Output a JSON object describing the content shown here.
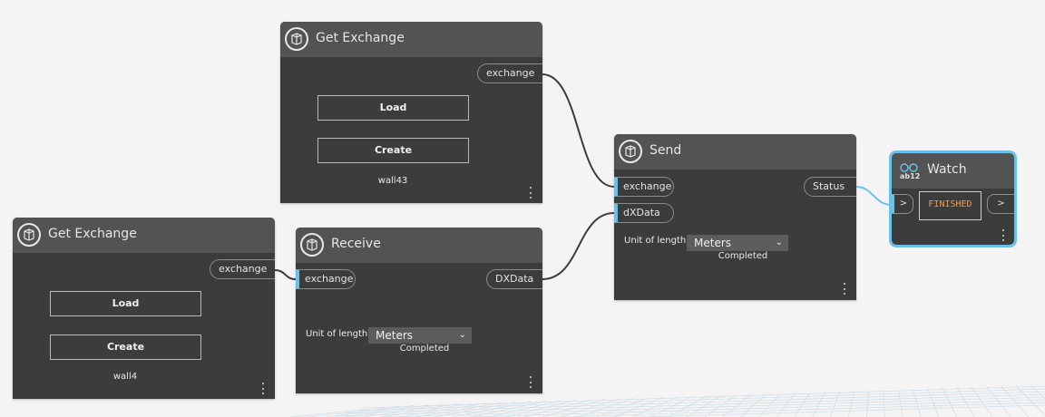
{
  "nodes": {
    "get_exchange_top": {
      "title": "Get Exchange",
      "output_port": "exchange",
      "load_label": "Load",
      "create_label": "Create",
      "caption": "wall43"
    },
    "get_exchange_bottom": {
      "title": "Get Exchange",
      "output_port": "exchange",
      "load_label": "Load",
      "create_label": "Create",
      "caption": "wall4"
    },
    "receive": {
      "title": "Receive",
      "input_port": "exchange",
      "output_port": "DXData",
      "unit_label": "Unit of length",
      "unit_value": "Meters",
      "status": "Completed"
    },
    "send": {
      "title": "Send",
      "input_port_1": "exchange",
      "input_port_2": "dXData",
      "output_port": "Status",
      "unit_label": "Unit of length",
      "unit_value": "Meters",
      "status": "Completed"
    },
    "watch": {
      "title": "Watch",
      "icon_text": "ab12",
      "input_port": ">",
      "output_port": ">",
      "value": "FINISHED"
    }
  },
  "colors": {
    "canvas": "#f4f4f4",
    "node_body": "#3c3c3c",
    "node_header": "#535353",
    "accent": "#6ac0e6",
    "wire": "#3c3c3c",
    "watch_value": "#e0a060"
  }
}
